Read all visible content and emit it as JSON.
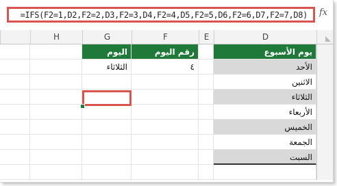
{
  "formula_bar": {
    "fx_label": "fx",
    "formula": "=IFS(F2=1,D2,F2=2,D3,F2=3,D4,F2=4,D5,F2=5,D6,F2=6,D7,F2=7,D8)"
  },
  "columns": [
    {
      "id": "A",
      "label": ""
    },
    {
      "id": "D",
      "label": "D"
    },
    {
      "id": "E",
      "label": "E"
    },
    {
      "id": "F",
      "label": "F"
    },
    {
      "id": "G",
      "label": "G"
    },
    {
      "id": "H",
      "label": "H"
    }
  ],
  "headers": {
    "d": "يوم الأسبوع",
    "f": "رقم اليوم",
    "g": "اليوم"
  },
  "rows": [
    {
      "d": "الأحد",
      "f": "٤",
      "g": "الثلاثاء"
    },
    {
      "d": "الاثنين",
      "f": "",
      "g": ""
    },
    {
      "d": "الثلاثاء",
      "f": "",
      "g": ""
    },
    {
      "d": "الأربعاء",
      "f": "",
      "g": ""
    },
    {
      "d": "الخميس",
      "f": "",
      "g": ""
    },
    {
      "d": "الجمعة",
      "f": "",
      "g": ""
    },
    {
      "d": "السبت",
      "f": "",
      "g": ""
    }
  ],
  "colors": {
    "header_green": "#1f7a3a",
    "band_gray": "#d9d9d9",
    "highlight_red": "#d9534f"
  }
}
